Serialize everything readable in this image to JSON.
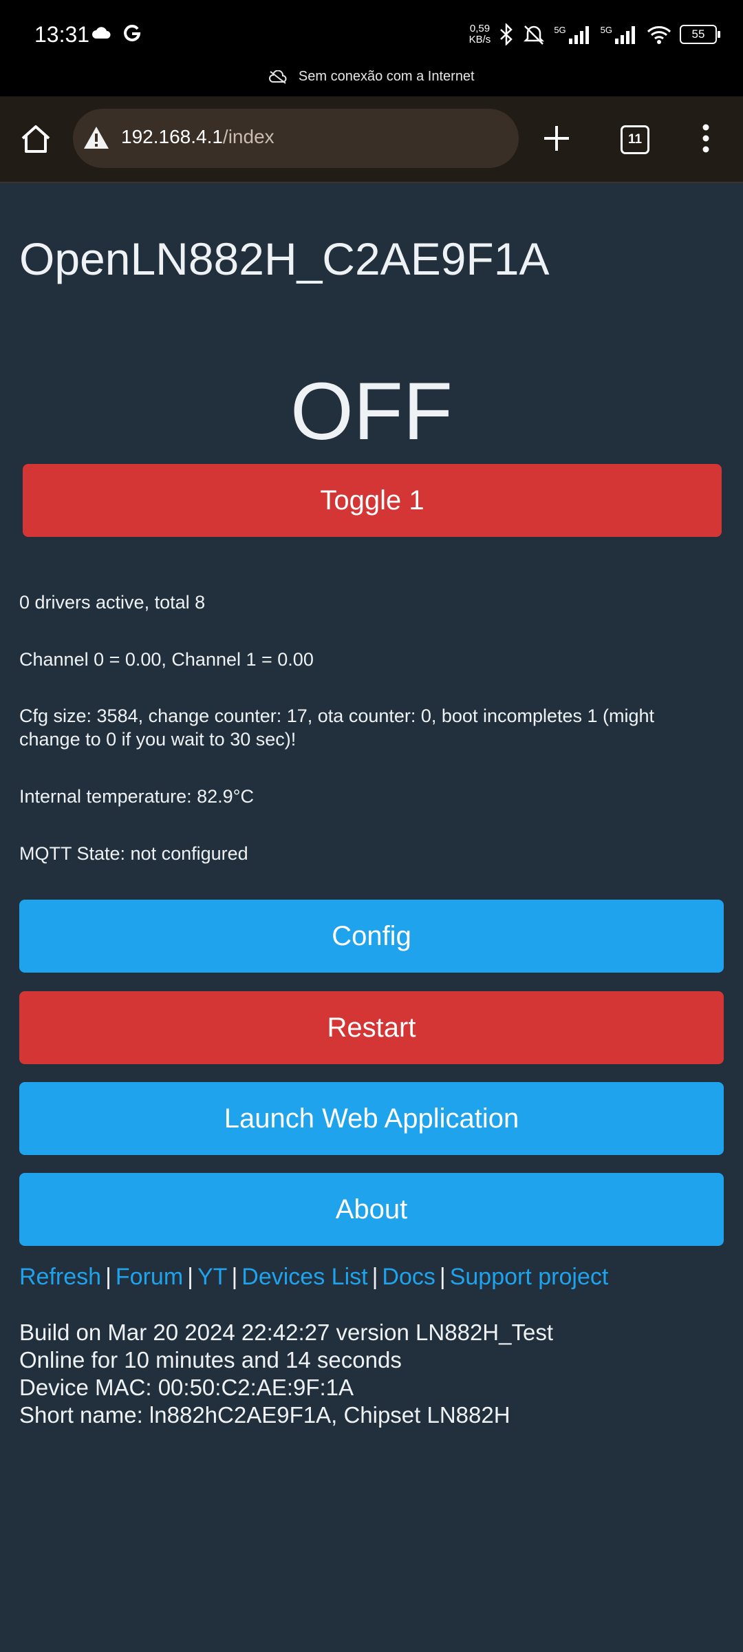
{
  "status_bar": {
    "time": "13:31",
    "speed_value": "0,59",
    "speed_unit": "KB/s",
    "battery": "55",
    "network_5g_a": "5G",
    "network_5g_b": "5G",
    "offline_text": "Sem conexão com a Internet",
    "icons": [
      "cloud-icon",
      "google-icon",
      "bluetooth-icon",
      "mute-icon",
      "signal-icon",
      "wifi-icon",
      "battery-icon"
    ]
  },
  "browser": {
    "url_host": "192.168.4.1",
    "url_path": "/index",
    "tab_count": "11",
    "icons": [
      "home-icon",
      "warning-icon",
      "plus-icon",
      "tabs-icon",
      "menu-icon"
    ]
  },
  "page": {
    "title": "OpenLN882H_C2AE9F1A",
    "state": "OFF",
    "toggle_label": "Toggle 1",
    "info": {
      "drivers": "0 drivers active, total 8",
      "channels": "Channel 0 = 0.00, Channel 1 = 0.00",
      "cfg": "Cfg size: 3584, change counter: 17, ota counter: 0, boot incompletes 1 (might change to 0 if you wait to 30 sec)!",
      "temperature": "Internal temperature: 82.9°C",
      "mqtt": "MQTT State: not configured"
    },
    "buttons": {
      "config": "Config",
      "restart": "Restart",
      "launch": "Launch Web Application",
      "about": "About"
    },
    "links": {
      "refresh": "Refresh",
      "forum": "Forum",
      "yt": "YT",
      "devices": "Devices List",
      "docs": "Docs",
      "support": "Support project",
      "separator": "|"
    },
    "build": {
      "line1": "Build on Mar 20 2024 22:42:27 version LN882H_Test",
      "line2": "Online for 10 minutes and 14 seconds",
      "line3": "Device MAC: 00:50:C2:AE:9F:1A",
      "line4": "Short name: ln882hC2AE9F1A, Chipset LN882H"
    }
  },
  "colors": {
    "background": "#222f3d",
    "red": "#d43535",
    "blue": "#1fa3ec",
    "toolbar": "#221c17"
  }
}
